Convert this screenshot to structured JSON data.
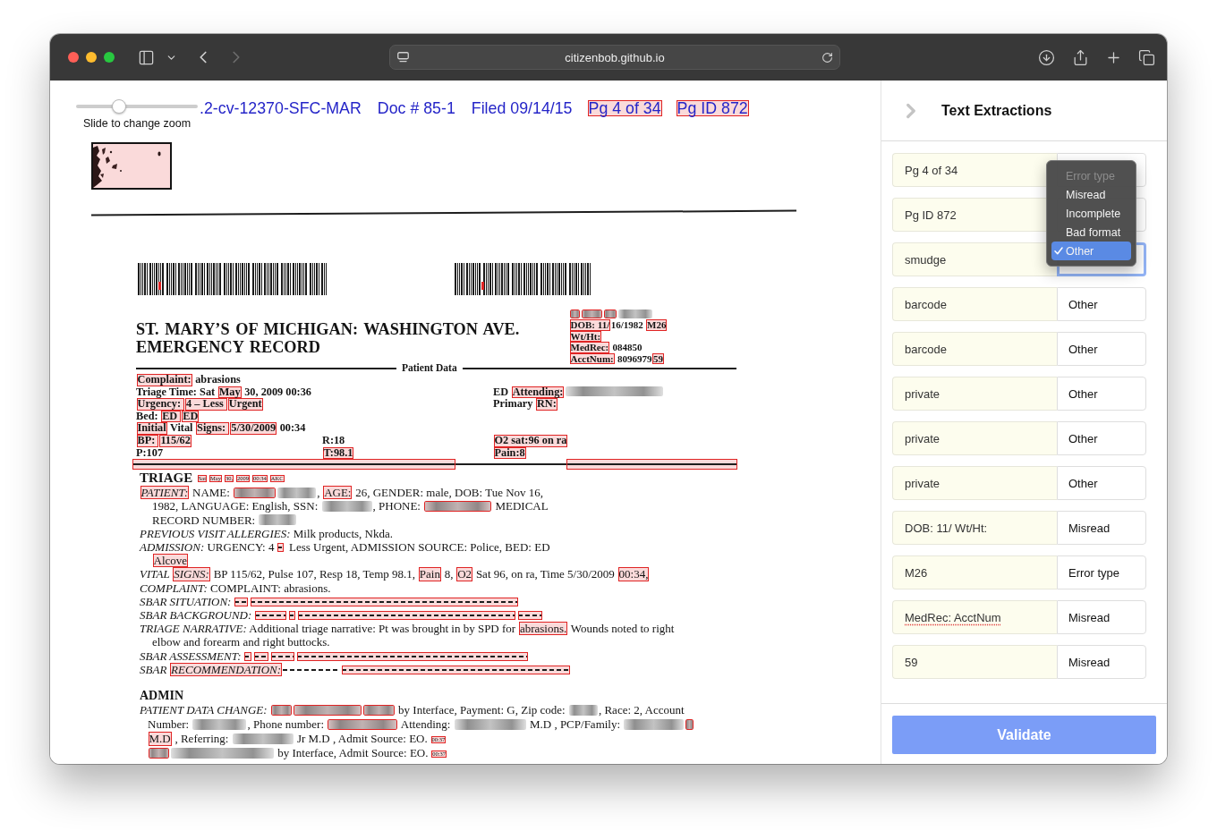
{
  "browser": {
    "url": "citizenbob.github.io",
    "nav": [
      {
        "kind": "back",
        "disabled": false
      },
      {
        "kind": "forward",
        "disabled": true
      }
    ]
  },
  "viewer": {
    "zoom": {
      "label": "Slide to change zoom",
      "level": 0.35
    },
    "header": [
      {
        "text": ".2-cv-12370-SFC-MAR",
        "flagged": false
      },
      {
        "text": "Doc # 85-1",
        "flagged": false
      },
      {
        "text": "Filed 09/14/15",
        "flagged": false
      },
      {
        "text": "Pg 4 of 34",
        "flagged": true
      },
      {
        "text": "Pg ID 872",
        "flagged": true
      }
    ]
  },
  "document": {
    "smudge": {
      "flagged": true
    },
    "barcodes": [
      {
        "flagged": true
      },
      {
        "flagged": true
      }
    ],
    "title": [
      "ST. MARY’S OF MICHIGAN: WASHINGTON AVE.",
      "EMERGENCY RECORD"
    ],
    "id_block": [
      [
        {
          "kind": "redacted",
          "flagged": true
        },
        {
          "kind": "redacted",
          "flagged": true
        },
        {
          "kind": "redacted",
          "flagged": true
        },
        {
          "kind": "redacted",
          "flagged": false
        }
      ],
      [
        {
          "kind": "text",
          "text": "DOB: 11/",
          "flagged": true
        },
        {
          "kind": "text",
          "text": "16/1982 ",
          "flagged": false
        },
        {
          "kind": "text",
          "text": "M26",
          "flagged": true
        }
      ],
      [
        {
          "kind": "text",
          "text": "Wt/Ht:",
          "flagged": true
        }
      ],
      [
        {
          "kind": "text",
          "text": "MedRec:",
          "flagged": true
        },
        {
          "kind": "text",
          "text": " 084850",
          "flagged": false
        }
      ],
      [
        {
          "kind": "text",
          "text": "AcctNum:",
          "flagged": true
        },
        {
          "kind": "text",
          "text": " 8096979",
          "flagged": false
        },
        {
          "kind": "text",
          "text": "59",
          "flagged": true
        }
      ]
    ],
    "patient_data": {
      "label": "Patient Data",
      "rows": [
        {
          "column_1": [
            {
              "kind": "text",
              "text": "Complaint:",
              "flagged": true
            },
            {
              "kind": "text",
              "text": " abrasions",
              "flagged": false
            }
          ]
        },
        {
          "column_1": [
            {
              "kind": "text",
              "text": "Triage Time: Sat ",
              "flagged": false
            },
            {
              "kind": "text",
              "text": "May",
              "flagged": true
            },
            {
              "kind": "text",
              "text": " 30, 2009 00:36",
              "flagged": false
            }
          ],
          "column_3": [
            {
              "kind": "text",
              "text": "ED ",
              "flagged": false
            },
            {
              "kind": "text",
              "text": "Attending:",
              "flagged": true
            },
            {
              "kind": "redacted",
              "flagged": false
            }
          ]
        },
        {
          "column_1": [
            {
              "kind": "text",
              "text": "Urgency: ",
              "flagged": true
            },
            {
              "kind": "text",
              "text": "4 – Less ",
              "flagged": true
            },
            {
              "kind": "text",
              "text": "Urgent",
              "flagged": true
            }
          ],
          "column_3": [
            {
              "kind": "text",
              "text": "Primary ",
              "flagged": false
            },
            {
              "kind": "text",
              "text": "RN:",
              "flagged": true
            }
          ]
        },
        {
          "column_1": [
            {
              "kind": "text",
              "text": "Bed: ",
              "flagged": false
            },
            {
              "kind": "text",
              "text": "ED ",
              "flagged": true
            },
            {
              "kind": "text",
              "text": "ED",
              "flagged": true
            }
          ]
        },
        {
          "column_1": [
            {
              "kind": "text",
              "text": "Initial",
              "flagged": true
            },
            {
              "kind": "text",
              "text": " Vital ",
              "flagged": false
            },
            {
              "kind": "text",
              "text": "Signs: ",
              "flagged": true
            },
            {
              "kind": "text",
              "text": "5/30/2009",
              "flagged": true
            },
            {
              "kind": "text",
              "text": " 00:34",
              "flagged": false
            }
          ]
        },
        {
          "column_1": [
            {
              "kind": "text",
              "text": "BP: ",
              "flagged": true
            },
            {
              "kind": "text",
              "text": "115/62",
              "flagged": true
            }
          ],
          "column_2": [
            {
              "kind": "text",
              "text": "R:18",
              "flagged": false
            }
          ],
          "column_3": [
            {
              "kind": "text",
              "text": "O2 sat:96 on ra",
              "flagged": true
            }
          ]
        },
        {
          "column_1": [
            {
              "kind": "text",
              "text": "P:107",
              "flagged": false
            }
          ],
          "column_2": [
            {
              "kind": "text",
              "text": "T:98.1",
              "flagged": true
            }
          ],
          "column_3": [
            {
              "kind": "text",
              "text": "Pain:8",
              "flagged": true
            }
          ]
        }
      ]
    },
    "separator": [
      {
        "flagged": true
      },
      {
        "flagged": false
      },
      {
        "flagged": true
      }
    ],
    "triage": {
      "heading": "TRIAGE",
      "stamps": [
        {
          "kind": "stamp",
          "text": "Sat",
          "flagged": true
        },
        {
          "kind": "stamp",
          "text": "May",
          "flagged": true
        },
        {
          "kind": "stamp",
          "text": "30,",
          "flagged": true
        },
        {
          "kind": "stamp",
          "text": "2009",
          "flagged": true
        },
        {
          "kind": "stamp",
          "text": "00:34",
          "flagged": true
        },
        {
          "kind": "stamp",
          "text": "AKC",
          "flagged": true
        }
      ],
      "paragraphs": [
        {
          "lines": [
            [
              {
                "kind": "label",
                "text": "PATIENT:",
                "flagged": true
              },
              {
                "kind": "text",
                "text": " NAME: ",
                "flagged": false
              },
              {
                "kind": "redacted",
                "flagged": true
              },
              {
                "kind": "redacted",
                "flagged": false
              },
              {
                "kind": "text",
                "text": ", ",
                "flagged": false
              },
              {
                "kind": "text",
                "text": "AGE:",
                "flagged": true
              },
              {
                "kind": "text",
                "text": " 26, GENDER: male, DOB: Tue Nov 16,",
                "flagged": false
              }
            ],
            [
              {
                "kind": "text",
                "text": "1982, LANGUAGE: English, SSN: ",
                "flagged": false
              },
              {
                "kind": "redacted",
                "flagged": false
              },
              {
                "kind": "text",
                "text": ", PHONE: ",
                "flagged": false
              },
              {
                "kind": "redacted",
                "flagged": true
              },
              {
                "kind": "text",
                "text": " MEDICAL",
                "flagged": false
              }
            ],
            [
              {
                "kind": "text",
                "text": "RECORD NUMBER: ",
                "flagged": false
              },
              {
                "kind": "redacted",
                "flagged": false
              }
            ]
          ]
        },
        {
          "lines": [
            [
              {
                "kind": "label",
                "text": "PREVIOUS VISIT ALLERGIES:",
                "flagged": false
              },
              {
                "kind": "text",
                "text": " Milk products, Nkda.",
                "flagged": false
              }
            ]
          ]
        },
        {
          "lines": [
            [
              {
                "kind": "label",
                "text": "ADMISSION:",
                "flagged": false
              },
              {
                "kind": "text",
                "text": " URGENCY: 4 ",
                "flagged": false
              },
              {
                "kind": "dashes",
                "flagged": true
              },
              {
                "kind": "text",
                "text": " Less Urgent, ADMISSION SOURCE: Police, BED: ED",
                "flagged": false
              }
            ],
            [
              {
                "kind": "text",
                "text": "Alcove",
                "flagged": true
              }
            ]
          ]
        },
        {
          "lines": [
            [
              {
                "kind": "label",
                "text": "VITAL ",
                "flagged": false
              },
              {
                "kind": "label",
                "text": "SIGNS:",
                "flagged": true
              },
              {
                "kind": "text",
                "text": " BP 115/62, Pulse 107, Resp 18, Temp 98.1, ",
                "flagged": false
              },
              {
                "kind": "text",
                "text": "Pain",
                "flagged": true
              },
              {
                "kind": "text",
                "text": " 8, ",
                "flagged": false
              },
              {
                "kind": "text",
                "text": "O2",
                "flagged": true
              },
              {
                "kind": "text",
                "text": " Sat 96, on ra, Time 5/30/2009 ",
                "flagged": false
              },
              {
                "kind": "text",
                "text": "00:34,",
                "flagged": true
              }
            ]
          ]
        },
        {
          "lines": [
            [
              {
                "kind": "label",
                "text": "COMPLAINT:",
                "flagged": false
              },
              {
                "kind": "text",
                "text": " COMPLAINT: abrasions.",
                "flagged": false
              }
            ]
          ]
        },
        {
          "lines": [
            [
              {
                "kind": "label",
                "text": "SBAR SITUATION: ",
                "flagged": false
              },
              {
                "kind": "dashes",
                "flagged": true
              },
              {
                "kind": "dashes",
                "flagged": true
              }
            ]
          ]
        },
        {
          "lines": [
            [
              {
                "kind": "label",
                "text": "SBAR BACKGROUND: ",
                "flagged": false
              },
              {
                "kind": "dashes",
                "flagged": true
              },
              {
                "kind": "dashes",
                "flagged": true
              },
              {
                "kind": "dashes",
                "flagged": true
              },
              {
                "kind": "dashes",
                "flagged": true
              }
            ]
          ]
        },
        {
          "lines": [
            [
              {
                "kind": "label",
                "text": "TRIAGE NARRATIVE:",
                "flagged": false
              },
              {
                "kind": "text",
                "text": " Additional triage narrative: Pt was brought in by SPD for ",
                "flagged": false
              },
              {
                "kind": "text",
                "text": "abrasions.",
                "flagged": true
              },
              {
                "kind": "text",
                "text": " Wounds noted to right",
                "flagged": false
              }
            ],
            [
              {
                "kind": "text",
                "text": "elbow and forearm and right buttocks.",
                "flagged": false
              }
            ]
          ]
        },
        {
          "lines": [
            [
              {
                "kind": "label",
                "text": "SBAR ASSESSMENT: ",
                "flagged": false
              },
              {
                "kind": "dashes",
                "flagged": true
              },
              {
                "kind": "dashes",
                "flagged": true
              },
              {
                "kind": "dashes",
                "flagged": true
              },
              {
                "kind": "dashes",
                "flagged": true
              }
            ]
          ]
        },
        {
          "lines": [
            [
              {
                "kind": "label",
                "text": "SBAR ",
                "flagged": false
              },
              {
                "kind": "label",
                "text": "RECOMMENDATION:",
                "flagged": true
              },
              {
                "kind": "dashes",
                "flagged": false
              },
              {
                "kind": "dashes",
                "flagged": true
              }
            ]
          ]
        }
      ]
    },
    "admin": {
      "heading": "ADMIN",
      "paragraphs": [
        {
          "lines": [
            [
              {
                "kind": "label",
                "text": "PATIENT DATA CHANGE: ",
                "flagged": false
              },
              {
                "kind": "redacted",
                "flagged": true
              },
              {
                "kind": "redacted",
                "flagged": true
              },
              {
                "kind": "redacted",
                "flagged": true
              },
              {
                "kind": "text",
                "text": " by Interface, Payment: G, Zip code: ",
                "flagged": false
              },
              {
                "kind": "redacted",
                "flagged": false
              },
              {
                "kind": "text",
                "text": ", Race: 2, Account",
                "flagged": false
              }
            ],
            [
              {
                "kind": "text",
                "text": "Number: ",
                "flagged": false
              },
              {
                "kind": "redacted",
                "flagged": false
              },
              {
                "kind": "text",
                "text": ", Phone number: ",
                "flagged": false
              },
              {
                "kind": "redacted",
                "flagged": true
              },
              {
                "kind": "text",
                "text": " Attending: ",
                "flagged": false
              },
              {
                "kind": "redacted",
                "flagged": false
              },
              {
                "kind": "text",
                "text": " M.D , PCP/Family: ",
                "flagged": false
              },
              {
                "kind": "redacted",
                "flagged": false
              },
              {
                "kind": "redacted",
                "flagged": true
              }
            ],
            [
              {
                "kind": "text",
                "text": "M.D",
                "flagged": true
              },
              {
                "kind": "text",
                "text": " , Referring: ",
                "flagged": false
              },
              {
                "kind": "redacted",
                "flagged": false
              },
              {
                "kind": "text",
                "text": " Jr M.D , Admit Source: EO. ",
                "flagged": false
              },
              {
                "kind": "stamp",
                "text": "00:37",
                "flagged": true
              }
            ],
            [
              {
                "kind": "redacted",
                "flagged": true
              },
              {
                "kind": "redacted",
                "flagged": false
              },
              {
                "kind": "text",
                "text": " by Interface, Admit Source: EO. ",
                "flagged": false
              },
              {
                "kind": "stamp",
                "text": "00:37",
                "flagged": true
              }
            ]
          ]
        }
      ]
    }
  },
  "sidebar": {
    "title": "Text Extractions",
    "rows": [
      {
        "text": "Pg 4 of 34",
        "misspelled": false,
        "focused": false
      },
      {
        "text": "Pg ID 872",
        "misspelled": false,
        "focused": false
      },
      {
        "text": "smudge",
        "misspelled": false,
        "focused": true,
        "menu": {
          "options": [
            {
              "label": "Error type",
              "disabled": true,
              "selected": false
            },
            {
              "label": "Misread",
              "disabled": false,
              "selected": false
            },
            {
              "label": "Incomplete",
              "disabled": false,
              "selected": false
            },
            {
              "label": "Bad format",
              "disabled": false,
              "selected": false
            },
            {
              "label": "Other",
              "disabled": false,
              "selected": true
            }
          ]
        }
      },
      {
        "text": "barcode",
        "misspelled": false,
        "focused": false,
        "error_type": "Other"
      },
      {
        "text": "barcode",
        "misspelled": false,
        "focused": false,
        "error_type": "Other"
      },
      {
        "text": "private",
        "misspelled": false,
        "focused": false,
        "error_type": "Other"
      },
      {
        "text": "private",
        "misspelled": false,
        "focused": false,
        "error_type": "Other"
      },
      {
        "text": "private",
        "misspelled": false,
        "focused": false,
        "error_type": "Other"
      },
      {
        "text": "DOB: 11/ Wt/Ht:",
        "misspelled": false,
        "focused": false,
        "error_type": "Misread"
      },
      {
        "text": "M26",
        "misspelled": false,
        "focused": false,
        "error_type": "Error type"
      },
      {
        "text": "MedRec: AcctNum",
        "misspelled": true,
        "focused": false,
        "error_type": "Misread"
      },
      {
        "text": "59",
        "misspelled": false,
        "focused": false,
        "error_type": "Misread"
      }
    ],
    "validate": "Validate"
  }
}
